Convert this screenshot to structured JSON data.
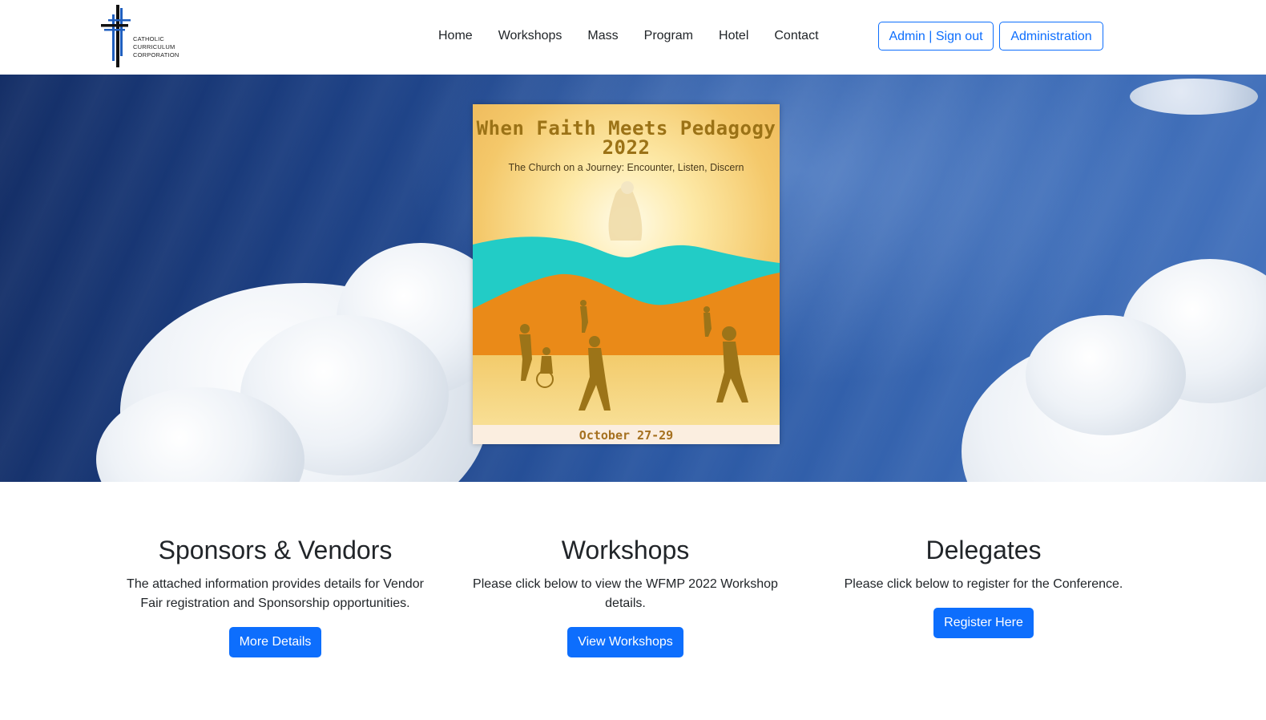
{
  "logo": {
    "lines": [
      "CATHOLIC",
      "CURRICULUM",
      "CORPORATION"
    ],
    "icon": "cross-logo-icon"
  },
  "nav": {
    "items": [
      "Home",
      "Workshops",
      "Mass",
      "Program",
      "Hotel",
      "Contact"
    ]
  },
  "header_buttons": {
    "admin_signout": "Admin | Sign out",
    "administration": "Administration"
  },
  "poster": {
    "title_line1": "When Faith Meets Pedagogy",
    "title_line2": "2022",
    "subtitle": "The Church on a Journey: Encounter, Listen, Discern",
    "date": "October 27-29"
  },
  "sections": [
    {
      "title": "Sponsors & Vendors",
      "text": "The attached information provides details for Vendor Fair registration and Sponsorship opportunities.",
      "button": "More Details"
    },
    {
      "title": "Workshops",
      "text": "Please click below to view the WFMP 2022 Workshop details.",
      "button": "View Workshops"
    },
    {
      "title": "Delegates",
      "text": "Please click below to register for the Conference.",
      "button": "Register Here"
    }
  ],
  "colors": {
    "primary": "#0d6efd",
    "sky": "#1c3f82"
  }
}
